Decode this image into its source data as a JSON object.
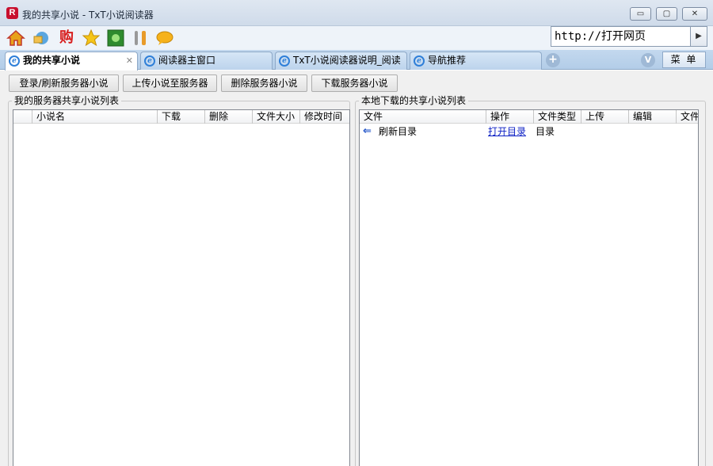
{
  "window": {
    "logo": "R",
    "title": "我的共享小说 - TxT小说阅读器",
    "controls": {
      "minimize": "▭",
      "maximize": "▢",
      "close": "✕"
    }
  },
  "toolbar": {
    "icons": [
      "home-icon",
      "settings-icon",
      "shop-icon",
      "favorites-star-icon",
      "game-icon",
      "tools-icon",
      "chat-icon"
    ],
    "shop_label": "购",
    "url": {
      "value": "http://打开网页",
      "go": "▶"
    }
  },
  "tabs": [
    {
      "label": "我的共享小说",
      "active": true,
      "close": "✕"
    },
    {
      "label": "阅读器主窗口",
      "active": false
    },
    {
      "label": "TxT小说阅读器说明_阅读",
      "active": false
    },
    {
      "label": "导航推荐",
      "active": false
    }
  ],
  "tabbar": {
    "new_tab": "+",
    "v_label": "V",
    "menu_label": "菜 单"
  },
  "actions": [
    {
      "label": "登录/刷新服务器小说"
    },
    {
      "label": "上传小说至服务器"
    },
    {
      "label": "删除服务器小说"
    },
    {
      "label": "下载服务器小说"
    }
  ],
  "server_list": {
    "group_label": "我的服务器共享小说列表",
    "columns": [
      "",
      "小说名",
      "下载",
      "删除",
      "文件大小",
      "修改时间"
    ],
    "rows": []
  },
  "local_list": {
    "group_label": "本地下载的共享小说列表",
    "columns": [
      "文件",
      "操作",
      "文件类型",
      "上传",
      "编辑",
      "文件"
    ],
    "rows": [
      {
        "icon": "back-arrow-icon",
        "arrow": "⇐",
        "name": "刷新目录",
        "action": "打开目录",
        "type": "目录"
      }
    ]
  }
}
